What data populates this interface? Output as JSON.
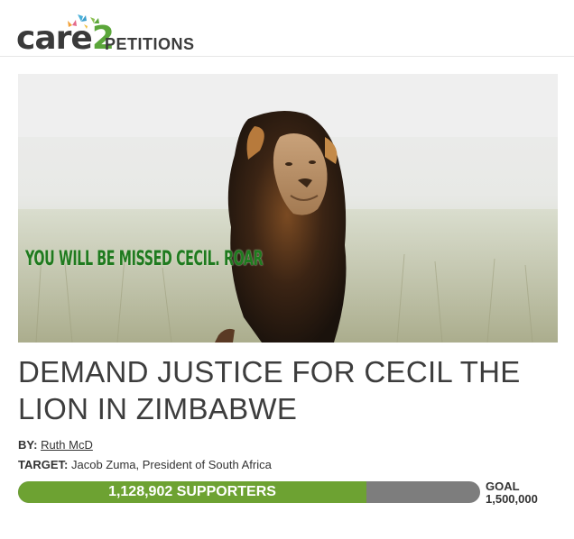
{
  "header": {
    "logo_main": "care",
    "logo_num": "2",
    "section": "PETITIONS"
  },
  "hero": {
    "caption": "YOU WILL BE MISSED CECIL. ROAR"
  },
  "petition": {
    "title": "DEMAND JUSTICE FOR CECIL THE LION IN ZIMBABWE",
    "by_label": "BY:",
    "by_name": "Ruth McD",
    "target_label": "TARGET:",
    "target_value": "Jacob Zuma, President of South Africa"
  },
  "progress": {
    "supporters_text": "1,128,902 SUPPORTERS",
    "fraction": 0.753,
    "goal_label": "GOAL",
    "goal_value": "1,500,000"
  },
  "colors": {
    "brand_green": "#6da232",
    "remaining_gray": "#7d7d7d"
  }
}
